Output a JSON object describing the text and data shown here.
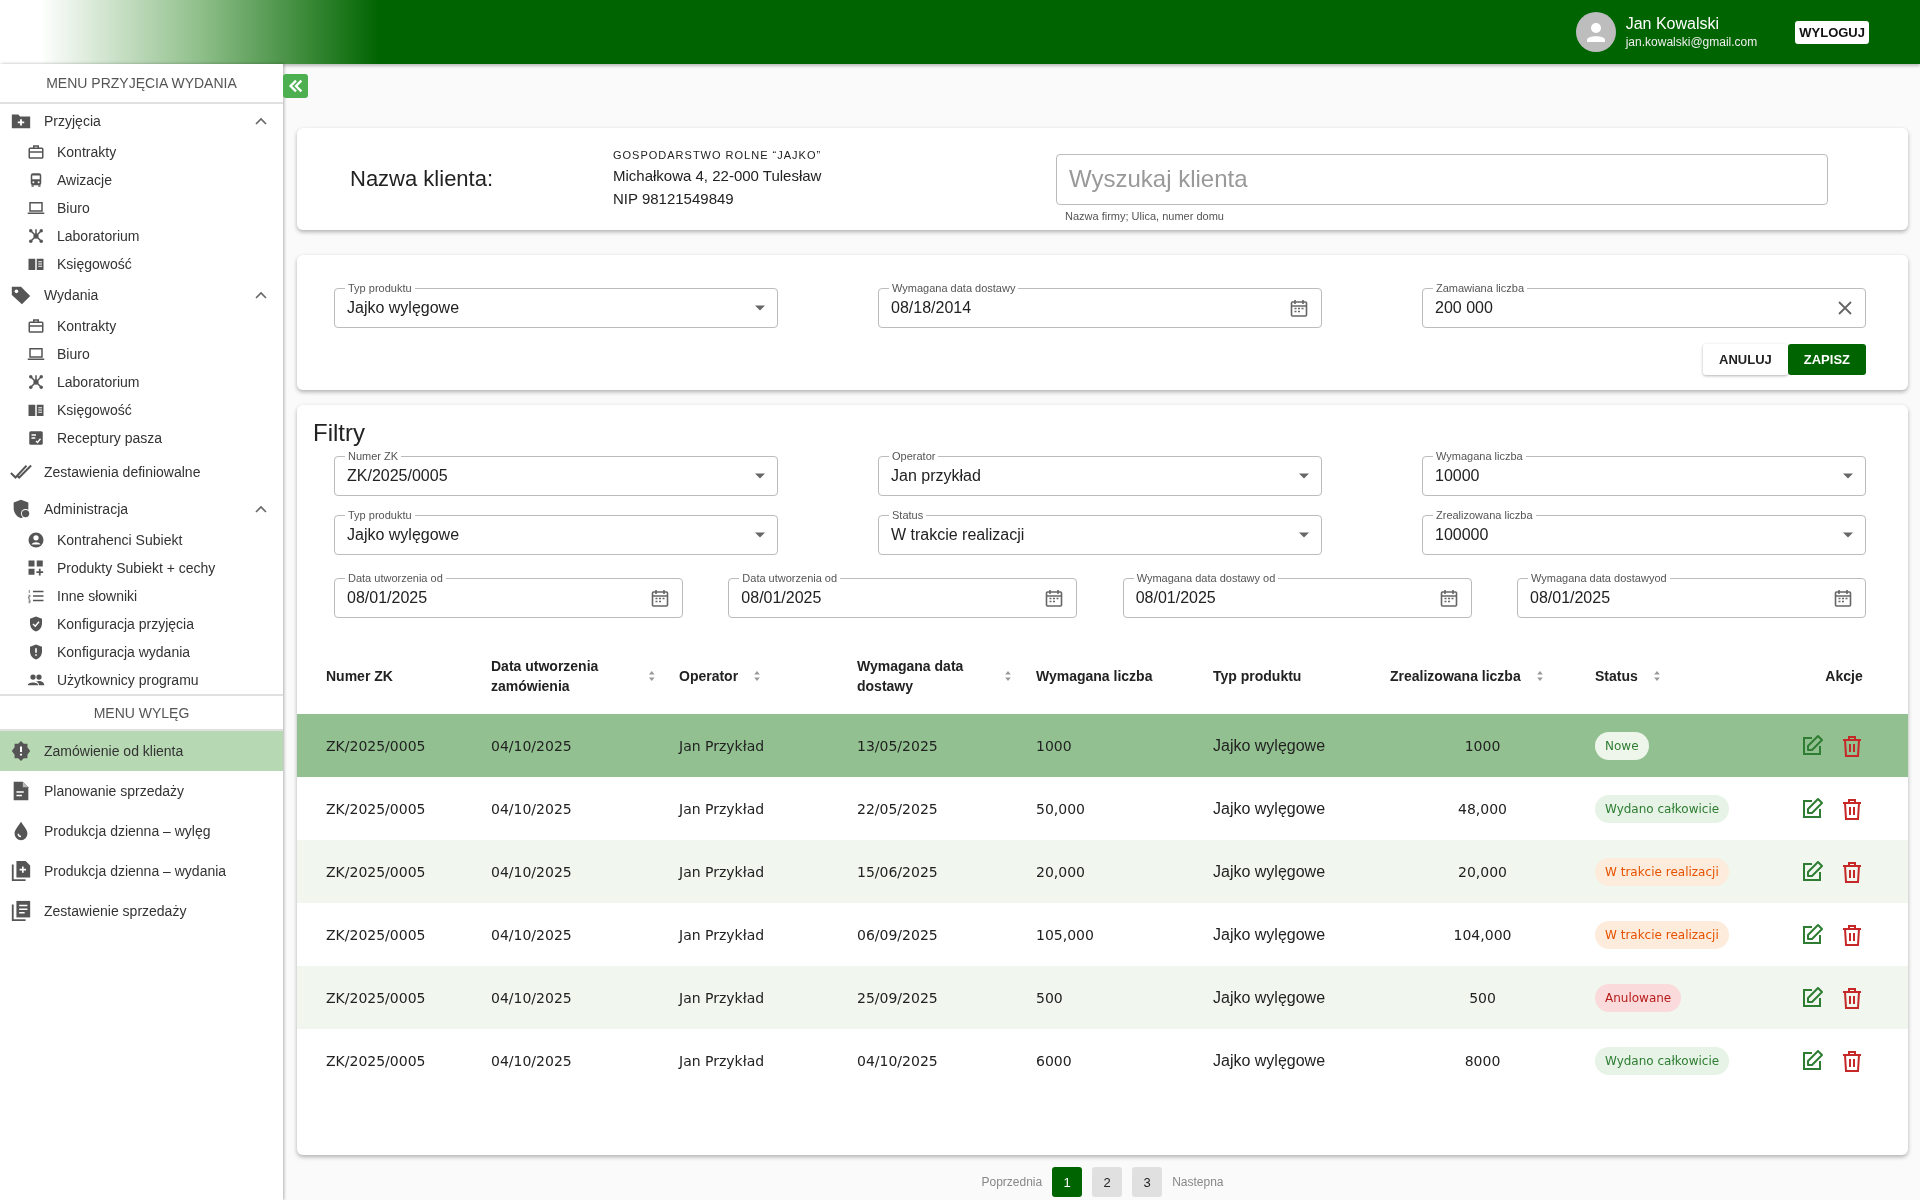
{
  "header": {
    "user": {
      "name": "Jan Kowalski",
      "email": "jan.kowalski@gmail.com"
    },
    "logout": "WYLOGUJ"
  },
  "sidebar": {
    "sections": [
      {
        "title": "MENU PRZYJĘCIA WYDANIA",
        "items": [
          {
            "label": "Przyjęcia",
            "selected": false,
            "expanded": true,
            "children": [
              {
                "label": "Kontrakty",
                "selected": false
              },
              {
                "label": "Awizacje",
                "selected": false
              },
              {
                "label": "Biuro",
                "selected": false
              },
              {
                "label": "Laboratorium",
                "selected": false
              },
              {
                "label": "Księgowość",
                "selected": false
              }
            ]
          },
          {
            "label": "Wydania",
            "selected": false,
            "expanded": true,
            "children": [
              {
                "label": "Kontrakty",
                "selected": false
              },
              {
                "label": "Biuro",
                "selected": false
              },
              {
                "label": "Laboratorium",
                "selected": false
              },
              {
                "label": "Księgowość",
                "selected": false
              },
              {
                "label": "Receptury pasza",
                "selected": false
              }
            ]
          },
          {
            "label": "Zestawienia definiowalne",
            "selected": false
          },
          {
            "label": "Administracja",
            "selected": false,
            "expanded": true,
            "children": [
              {
                "label": "Kontrahenci Subiekt",
                "selected": false
              },
              {
                "label": "Produkty Subiekt + cechy",
                "selected": false
              },
              {
                "label": "Inne słowniki",
                "selected": false
              },
              {
                "label": "Konfiguracja przyjęcia",
                "selected": false
              },
              {
                "label": "Konfiguracja wydania",
                "selected": false
              },
              {
                "label": "Użytkownicy programu",
                "selected": false
              }
            ]
          }
        ]
      },
      {
        "title": "MENU WYLĘG",
        "items": [
          {
            "label": "Zamówienie od klienta",
            "selected": true
          },
          {
            "label": "Planowanie sprzedaży",
            "selected": false
          },
          {
            "label": "Produkcja dzienna – wylęg",
            "selected": false
          },
          {
            "label": "Produkcja dzienna – wydania",
            "selected": false
          },
          {
            "label": "Zestawienie sprzedaży",
            "selected": false
          }
        ]
      }
    ]
  },
  "client": {
    "label": "Nazwa klienta:",
    "company": "GOSPODARSTWO ROLNE “JAJKO”",
    "address": "Michałkowa 4, 22-000 Tulesław",
    "nip": "NIP 98121549849",
    "search": {
      "placeholder": "Wyszukaj klienta",
      "hint": "Nazwa firmy; Ulica, numer domu"
    }
  },
  "order_form": {
    "fields": [
      {
        "kind": "select",
        "label": "Typ produktu",
        "value": "Jajko wylęgowe"
      },
      {
        "kind": "date",
        "label": "Wymagana data dostawy",
        "value": "08/18/2014"
      },
      {
        "kind": "clearable",
        "label": "Zamawiana liczba",
        "value": "200 000"
      }
    ],
    "buttons": [
      {
        "kind": "secondary",
        "label": "ANULUJ"
      },
      {
        "kind": "primary",
        "label": "ZAPISZ"
      }
    ]
  },
  "filters": {
    "title": "Filtry",
    "rows": [
      {
        "fields": [
          {
            "kind": "select",
            "label": "Numer ZK",
            "value": "ZK/2025/0005"
          },
          {
            "kind": "select",
            "label": "Operator",
            "value": "Jan przykład"
          },
          {
            "kind": "select",
            "label": "Wymagana liczba",
            "value": "10000"
          }
        ]
      },
      {
        "fields": [
          {
            "kind": "select",
            "label": "Typ produktu",
            "value": "Jajko wylęgowe"
          },
          {
            "kind": "select",
            "label": "Status",
            "value": "W trakcie realizacji"
          },
          {
            "kind": "select",
            "label": "Zrealizowana liczba",
            "value": "100000"
          }
        ]
      },
      {
        "fields": [
          {
            "kind": "date",
            "label": "Data utworzenia od",
            "value": "08/01/2025"
          },
          {
            "kind": "date",
            "label": "Data utworzenia od",
            "value": "08/01/2025"
          },
          {
            "kind": "date",
            "label": "Wymagana data dostawy od",
            "value": "08/01/2025"
          },
          {
            "kind": "date",
            "label": "Wymagana data dostawyod",
            "value": "08/01/2025"
          }
        ]
      }
    ]
  },
  "table": {
    "columns": [
      {
        "label": "Numer ZK",
        "sortable": false
      },
      {
        "label": "Data utworzenia zamówienia",
        "sortable": true
      },
      {
        "label": "Operator",
        "sortable": true
      },
      {
        "label": "Wymagana data dostawy",
        "sortable": true
      },
      {
        "label": "Wymagana liczba",
        "sortable": false
      },
      {
        "label": "Typ produktu",
        "sortable": false
      },
      {
        "label": "Zrealizowana liczba",
        "sortable": true
      },
      {
        "label": "Status",
        "sortable": true
      },
      {
        "label": "Akcje",
        "sortable": false
      }
    ],
    "rows": [
      {
        "selected": true,
        "cells": [
          "ZK/2025/0005",
          "04/10/2025",
          "Jan Przykład",
          "13/05/2025",
          "1000",
          "Jajko wylęgowe",
          "1000"
        ],
        "status": {
          "kind": "new",
          "label": "Nowe"
        }
      },
      {
        "selected": false,
        "cells": [
          "ZK/2025/0005",
          "04/10/2025",
          "Jan Przykład",
          "22/05/2025",
          "50,000",
          "Jajko wylęgowe",
          "48,000"
        ],
        "status": {
          "kind": "done",
          "label": "Wydano całkowicie"
        }
      },
      {
        "selected": false,
        "cells": [
          "ZK/2025/0005",
          "04/10/2025",
          "Jan Przykład",
          "15/06/2025",
          "20,000",
          "Jajko wylęgowe",
          "20,000"
        ],
        "status": {
          "kind": "progress",
          "label": "W trakcie realizacji"
        }
      },
      {
        "selected": false,
        "cells": [
          "ZK/2025/0005",
          "04/10/2025",
          "Jan Przykład",
          "06/09/2025",
          "105,000",
          "Jajko wylęgowe",
          "104,000"
        ],
        "status": {
          "kind": "progress",
          "label": "W trakcie realizacji"
        }
      },
      {
        "selected": false,
        "cells": [
          "ZK/2025/0005",
          "04/10/2025",
          "Jan Przykład",
          "25/09/2025",
          "500",
          "Jajko wylęgowe",
          "500"
        ],
        "status": {
          "kind": "cancelled",
          "label": "Anulowane"
        }
      },
      {
        "selected": false,
        "cells": [
          "ZK/2025/0005",
          "04/10/2025",
          "Jan Przykład",
          "04/10/2025",
          "6000",
          "Jajko wylęgowe",
          "8000"
        ],
        "status": {
          "kind": "done",
          "label": "Wydano całkowicie"
        }
      }
    ]
  },
  "pagination": {
    "previous": "Poprzednia",
    "pages": [
      {
        "label": "1",
        "selected": true
      },
      {
        "label": "2",
        "selected": false
      },
      {
        "label": "3",
        "selected": false
      }
    ],
    "next": "Nastepna"
  }
}
